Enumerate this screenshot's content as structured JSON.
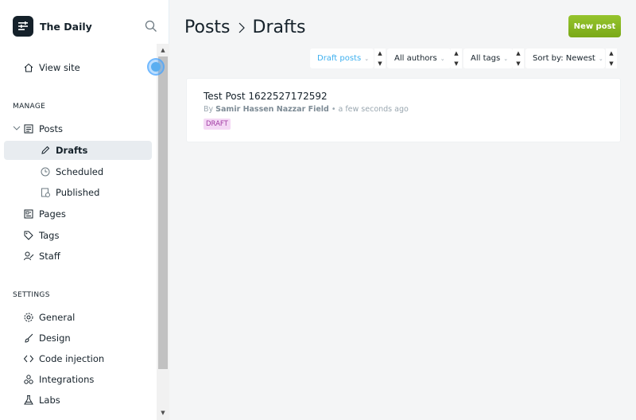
{
  "sidebar": {
    "brand": "The Daily",
    "view_site": "View site",
    "manage_label": "MANAGE",
    "items": [
      {
        "label": "Posts"
      },
      {
        "label": "Drafts"
      },
      {
        "label": "Scheduled"
      },
      {
        "label": "Published"
      },
      {
        "label": "Pages"
      },
      {
        "label": "Tags"
      },
      {
        "label": "Staff"
      }
    ],
    "settings_label": "SETTINGS",
    "settings_items": [
      {
        "label": "General"
      },
      {
        "label": "Design"
      },
      {
        "label": "Code injection"
      },
      {
        "label": "Integrations"
      },
      {
        "label": "Labs"
      }
    ]
  },
  "header": {
    "crumb_root": "Posts",
    "crumb_current": "Drafts",
    "new_post": "New post"
  },
  "filters": {
    "type": "Draft posts",
    "author": "All authors",
    "tag": "All tags",
    "sort": "Sort by: Newest"
  },
  "posts": [
    {
      "title": "Test Post 1622527172592",
      "by": "By",
      "author": "Samir Hassen Nazzar Field",
      "time": "• a few seconds ago",
      "status": "DRAFT"
    }
  ],
  "colors": {
    "accent": "#3eb0ef",
    "new_post_green": "#86b51f",
    "draft_badge_bg": "#f4d8f5",
    "draft_badge_text": "#a03aa3",
    "sidebar_active": "#e8ecf0"
  }
}
